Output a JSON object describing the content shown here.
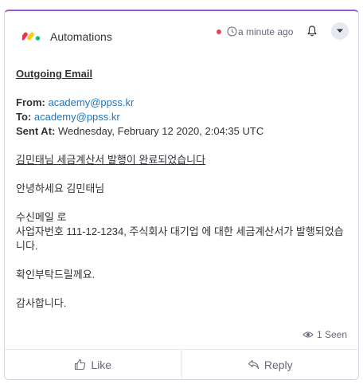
{
  "header": {
    "app_name": "Automations",
    "time": "a minute ago",
    "icons": {
      "logo": "monday-logo",
      "clock": "clock-icon",
      "bell": "bell-icon",
      "menu": "chevron-down-icon"
    },
    "unread_color": "#e2445c"
  },
  "email": {
    "title": "Outgoing Email",
    "from_label": "From:",
    "from_value": "academy@ppss.kr",
    "to_label": "To:",
    "to_value": "academy@ppss.kr",
    "sent_label": "Sent At:",
    "sent_value": "Wednesday, February 12 2020, 2:04:35 UTC",
    "subject": "김민태님 세금계산서 발행이 완료되었습니다",
    "greeting": "안녕하세요 김민태님",
    "body_line1": "수신메일 로",
    "body_line2": "사업자번호 111-12-1234, 주식회사 대기업 에 대한 세금계산서가 발행되었습니다.",
    "body_line3": "확인부탁드릴께요.",
    "closing": "감사합니다."
  },
  "seen": {
    "count_text": "1 Seen"
  },
  "footer": {
    "like_label": "Like",
    "reply_label": "Reply"
  },
  "colors": {
    "accent_top": "#9b59d0",
    "link": "#1f76c2"
  }
}
